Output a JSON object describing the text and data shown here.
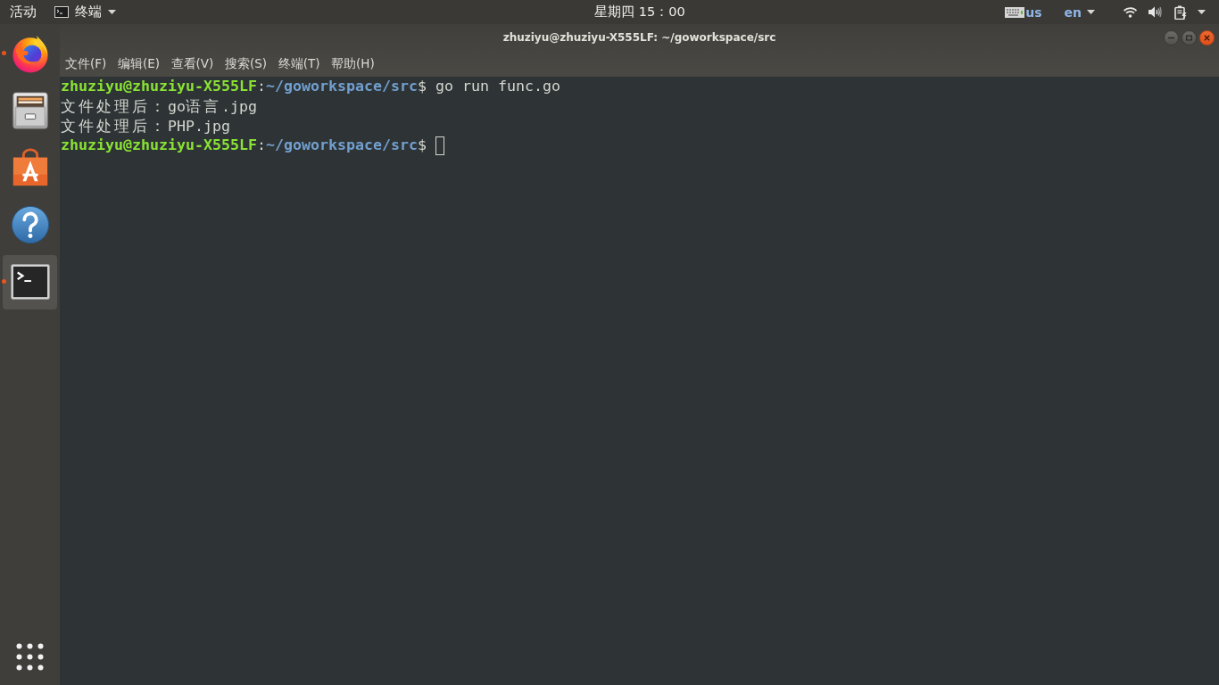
{
  "top_bar": {
    "activities": "活动",
    "app_menu": {
      "label": "终端"
    },
    "clock": "星期四 15：00",
    "keyboard_layout": "us",
    "input_method": "en"
  },
  "dock": {
    "items": [
      {
        "kind": "browser",
        "running": true,
        "selected": false
      },
      {
        "kind": "files",
        "running": false,
        "selected": false
      },
      {
        "kind": "store",
        "running": false,
        "selected": false
      },
      {
        "kind": "help",
        "running": false,
        "selected": false
      },
      {
        "kind": "terminal",
        "running": true,
        "selected": true
      }
    ]
  },
  "window": {
    "title": "zhuziyu@zhuziyu-X555LF: ~/goworkspace/src",
    "menu": [
      "文件(F)",
      "编辑(E)",
      "查看(V)",
      "搜索(S)",
      "终端(T)",
      "帮助(H)"
    ]
  },
  "terminal": {
    "lines": [
      {
        "kind": "prompt",
        "user_host": "zhuziyu@zhuziyu-X555LF",
        "separator": ":",
        "path": "~/goworkspace/src",
        "symbol": "$",
        "command": "go run func.go",
        "cursor": false
      },
      {
        "kind": "output",
        "text": "文件处理后：go语言.jpg",
        "cursor": false
      },
      {
        "kind": "output",
        "text": "文件处理后：PHP.jpg",
        "cursor": false
      },
      {
        "kind": "prompt",
        "user_host": "zhuziyu@zhuziyu-X555LF",
        "separator": ":",
        "path": "~/goworkspace/src",
        "symbol": "$",
        "cursor": true
      }
    ]
  }
}
